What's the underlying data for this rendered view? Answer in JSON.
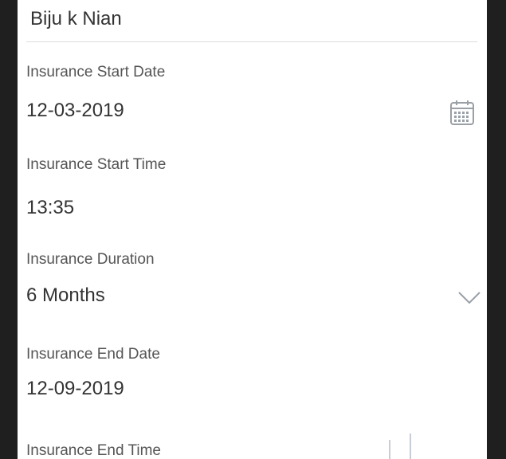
{
  "form": {
    "name_value": "Biju k Nian",
    "start_date": {
      "label": "Insurance Start Date",
      "value": "12-03-2019"
    },
    "start_time": {
      "label": "Insurance Start Time",
      "value": "13:35"
    },
    "duration": {
      "label": "Insurance Duration",
      "value": "6 Months"
    },
    "end_date": {
      "label": "Insurance End Date",
      "value": "12-09-2019"
    },
    "end_time": {
      "label": "Insurance End Time"
    }
  },
  "icons": {
    "calendar": "calendar-icon",
    "dropdown": "chevron-down-icon"
  },
  "colors": {
    "background": "#1f1f1f",
    "card": "#ffffff",
    "text_primary": "#333333",
    "text_label": "#555555",
    "divider": "#dcdcdc",
    "icon": "#9aa0a6"
  }
}
